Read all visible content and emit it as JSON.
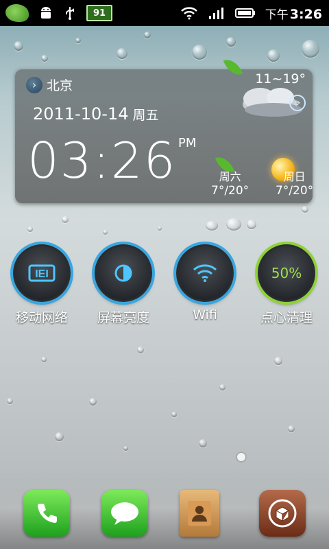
{
  "status_bar": {
    "battery": "91",
    "ampm": "下午",
    "time": "3:26",
    "icons": [
      "peas-app-icon",
      "android-icon",
      "usb-icon",
      "battery-icon",
      "wifi-icon",
      "signal-icon",
      "battery-status-icon"
    ]
  },
  "widget": {
    "city": "北京",
    "date": "2011-10-14",
    "weekday": "周五",
    "time": "03:26",
    "ampm": "PM",
    "temp_range": "11~19°",
    "forecast": [
      {
        "day": "周六",
        "temp": "7°/20°"
      },
      {
        "day": "周日",
        "temp": "7°/20°"
      }
    ]
  },
  "toggles": [
    {
      "label": "移动网络"
    },
    {
      "label": "屏幕亮度"
    },
    {
      "label": "Wifi"
    },
    {
      "label": "点心清理",
      "value": "50%"
    }
  ],
  "dock": [
    "phone-app",
    "messages-app",
    "contacts-app",
    "app-store"
  ],
  "colors": {
    "toggle_ring": "#39a6e0",
    "clean_ring": "#8fd238",
    "statusbar_bg": "#000000"
  }
}
